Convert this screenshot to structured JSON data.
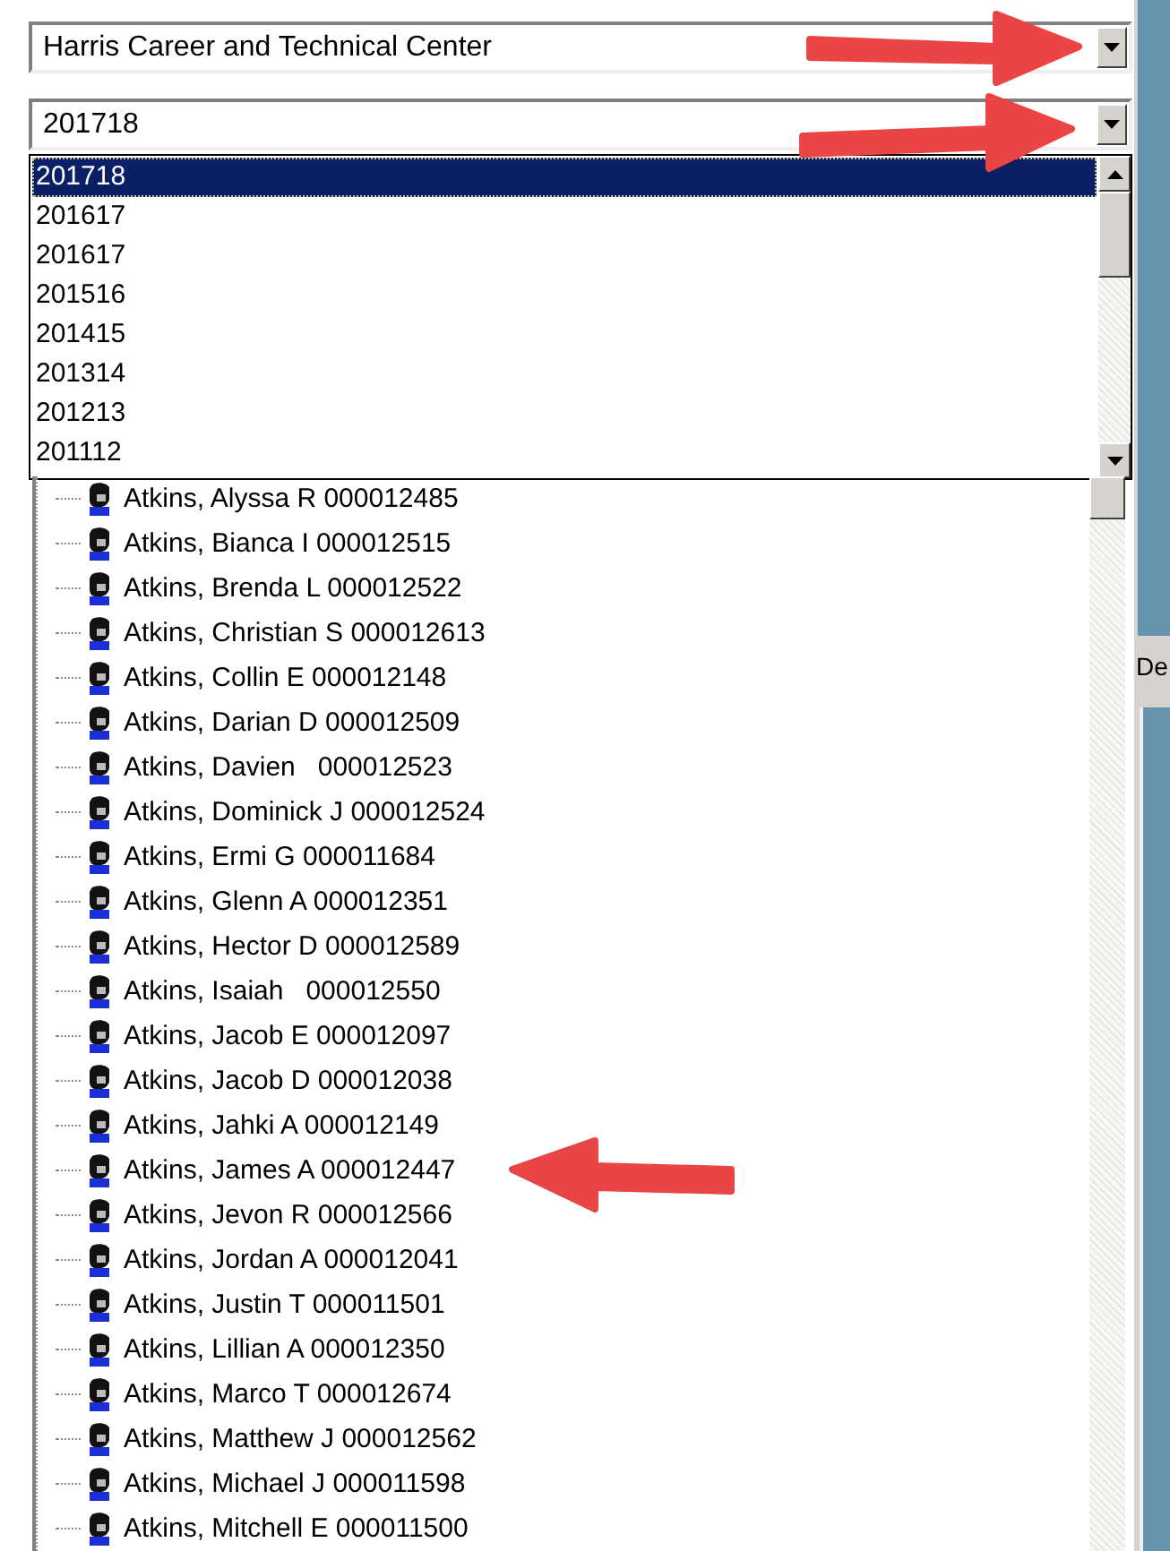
{
  "school_select": {
    "value": "Harris Career and Technical Center"
  },
  "year_select": {
    "value": "201718",
    "expanded": true
  },
  "year_options": [
    {
      "label": "201718",
      "selected": true
    },
    {
      "label": "201617",
      "selected": false
    },
    {
      "label": "201617",
      "selected": false
    },
    {
      "label": "201516",
      "selected": false
    },
    {
      "label": "201415",
      "selected": false
    },
    {
      "label": "201314",
      "selected": false
    },
    {
      "label": "201213",
      "selected": false
    },
    {
      "label": "201112",
      "selected": false
    }
  ],
  "students": [
    {
      "label": "Atkins, Alyssa R 000012485"
    },
    {
      "label": "Atkins, Bianca I 000012515"
    },
    {
      "label": "Atkins, Brenda L 000012522"
    },
    {
      "label": "Atkins, Christian S 000012613"
    },
    {
      "label": "Atkins, Collin E 000012148"
    },
    {
      "label": "Atkins, Darian D 000012509"
    },
    {
      "label": "Atkins, Davien   000012523"
    },
    {
      "label": "Atkins, Dominick J 000012524"
    },
    {
      "label": "Atkins, Ermi G 000011684"
    },
    {
      "label": "Atkins, Glenn A 000012351"
    },
    {
      "label": "Atkins, Hector D 000012589"
    },
    {
      "label": "Atkins, Isaiah   000012550"
    },
    {
      "label": "Atkins, Jacob E 000012097"
    },
    {
      "label": "Atkins, Jacob D 000012038"
    },
    {
      "label": "Atkins, Jahki A 000012149"
    },
    {
      "label": "Atkins, James A 000012447"
    },
    {
      "label": "Atkins, Jevon R 000012566"
    },
    {
      "label": "Atkins, Jordan A 000012041"
    },
    {
      "label": "Atkins, Justin T 000011501"
    },
    {
      "label": "Atkins, Lillian A 000012350"
    },
    {
      "label": "Atkins, Marco T 000012674"
    },
    {
      "label": "Atkins, Matthew J 000012562"
    },
    {
      "label": "Atkins, Michael J 000011598"
    },
    {
      "label": "Atkins, Mitchell E 000011500"
    }
  ],
  "right_panel": {
    "tab_label": "De"
  }
}
